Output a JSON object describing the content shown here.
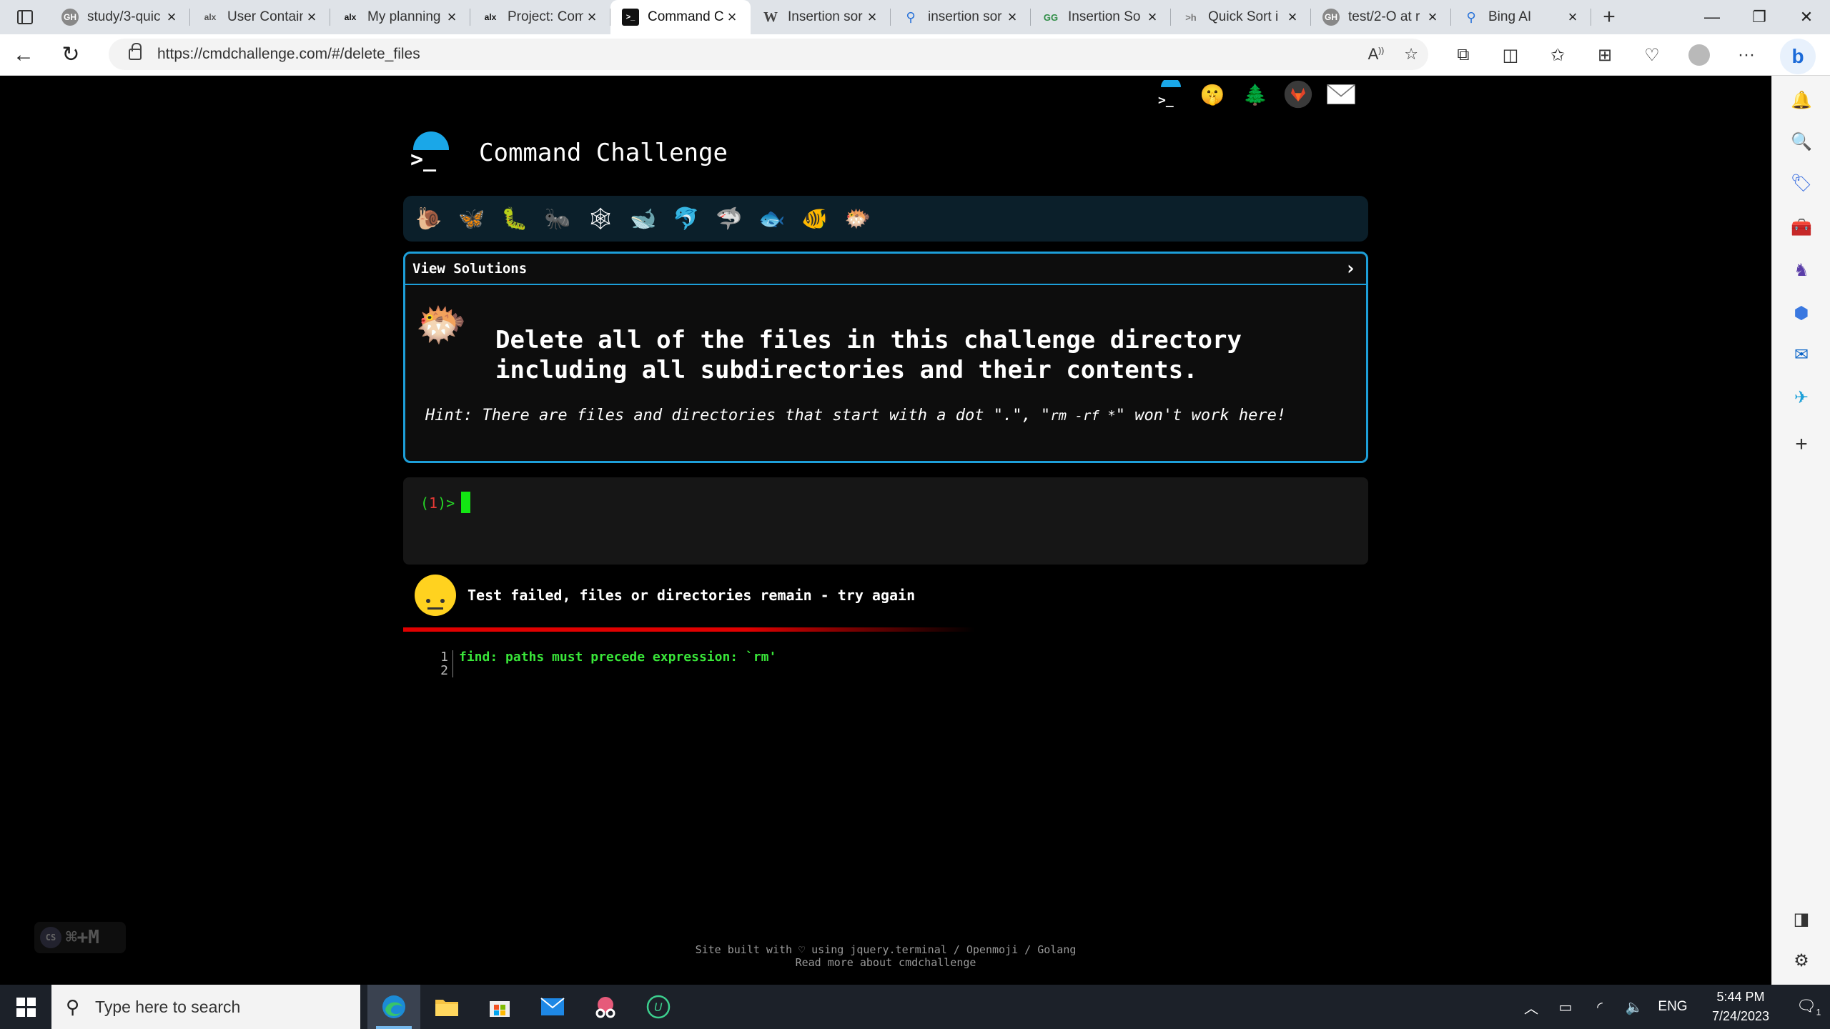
{
  "browser": {
    "tabs": [
      {
        "title": "study/3-quic",
        "favicon": "github-icon",
        "active": false
      },
      {
        "title": "User Contain",
        "favicon": "alx-icon",
        "active": false
      },
      {
        "title": "My planning",
        "favicon": "alx-icon",
        "active": false
      },
      {
        "title": "Project: Com",
        "favicon": "alx-icon",
        "active": false
      },
      {
        "title": "Command C",
        "favicon": "terminal-icon",
        "active": true
      },
      {
        "title": "Insertion sor",
        "favicon": "wikipedia-icon",
        "active": false
      },
      {
        "title": "insertion sor",
        "favicon": "search-icon",
        "active": false
      },
      {
        "title": "Insertion So",
        "favicon": "geeksforgeeks-icon",
        "active": false
      },
      {
        "title": "Quick Sort i",
        "favicon": "h-icon",
        "active": false
      },
      {
        "title": "test/2-O at r",
        "favicon": "github-icon",
        "active": false
      },
      {
        "title": "Bing AI",
        "favicon": "search-icon",
        "active": false
      }
    ],
    "url": "https://cmdchallenge.com/#/delete_files"
  },
  "page": {
    "brand_title": "Command Challenge",
    "top_icons": [
      "terminal-logo-icon",
      "hint-emoji-icon",
      "tree-icon",
      "gitlab-icon",
      "mail-icon"
    ],
    "levels": [
      {
        "name": "snail-icon",
        "glyph": "🐌"
      },
      {
        "name": "butterfly-icon",
        "glyph": "🦋"
      },
      {
        "name": "caterpillar-icon",
        "glyph": "🐛"
      },
      {
        "name": "ant-icon",
        "glyph": "🐜"
      },
      {
        "name": "spider-web-icon",
        "glyph": "🕸"
      },
      {
        "name": "whale-icon",
        "glyph": "🐋"
      },
      {
        "name": "dolphin-icon",
        "glyph": "🐬"
      },
      {
        "name": "shark-icon",
        "glyph": "🦈"
      },
      {
        "name": "fish-icon",
        "glyph": "🐟"
      },
      {
        "name": "tropical-fish-icon",
        "glyph": "🐠"
      },
      {
        "name": "blowfish-icon",
        "glyph": "🐡"
      }
    ],
    "solutions_label": "View Solutions",
    "challenge_text": "Delete all of the files in this challenge directory including all subdirectories and their contents.",
    "hint_prefix": "Hint: There are files and directories that start with a dot \".\", \"",
    "hint_code": "rm -rf *",
    "hint_suffix": "\" won't work here!",
    "prompt_open": "(",
    "prompt_num": "1",
    "prompt_close": ")>",
    "result_text": "Test failed, files or directories remain - try again",
    "output_lines": [
      {
        "n": "1",
        "text": "find: paths must precede expression: `rm'"
      },
      {
        "n": "2",
        "text": ""
      }
    ],
    "footer_line1": "Site built with ♡ using jquery.terminal / Openmoji / Golang",
    "footer_line2": "Read more about cmdchallenge",
    "cs_badge": "⌘+M",
    "cs_label": "CS"
  },
  "taskbar": {
    "search_placeholder": "Type here to search",
    "time": "5:44 PM",
    "date": "7/24/2023",
    "language": "ENG",
    "notification_count": "1"
  },
  "colors": {
    "accent_blue": "#1d9fd9",
    "prompt_green": "#26d926",
    "cursor_green": "#13e613",
    "error_red": "#e00000",
    "output_green": "#39e639"
  }
}
